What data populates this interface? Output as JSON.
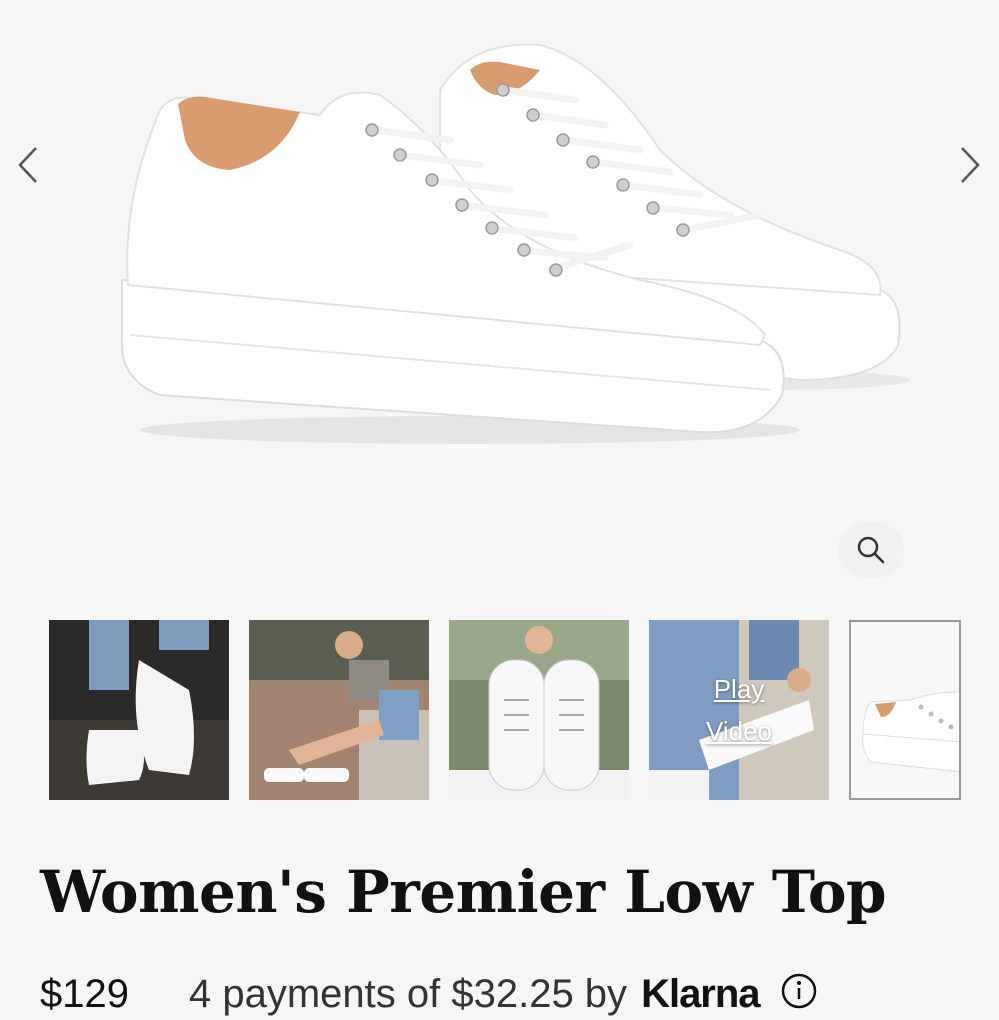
{
  "gallery": {
    "prev_icon": "chevron-left-icon",
    "next_icon": "chevron-right-icon",
    "zoom_icon": "magnifier-icon",
    "thumbnails": [
      {
        "name": "thumb-1",
        "play_label": ""
      },
      {
        "name": "thumb-2",
        "play_label": ""
      },
      {
        "name": "thumb-3",
        "play_label": ""
      },
      {
        "name": "thumb-4",
        "play_label": "Play\nVideo"
      },
      {
        "name": "thumb-5",
        "play_label": "",
        "selected": true
      }
    ]
  },
  "product": {
    "title": "Women's Premier Low Top",
    "price": "$129",
    "installments_text": "4 payments of $32.25 by",
    "klarna": "Klarna",
    "info_icon": "info-icon"
  },
  "colors": {
    "background": "#f6f6f6",
    "title": "#111111"
  }
}
